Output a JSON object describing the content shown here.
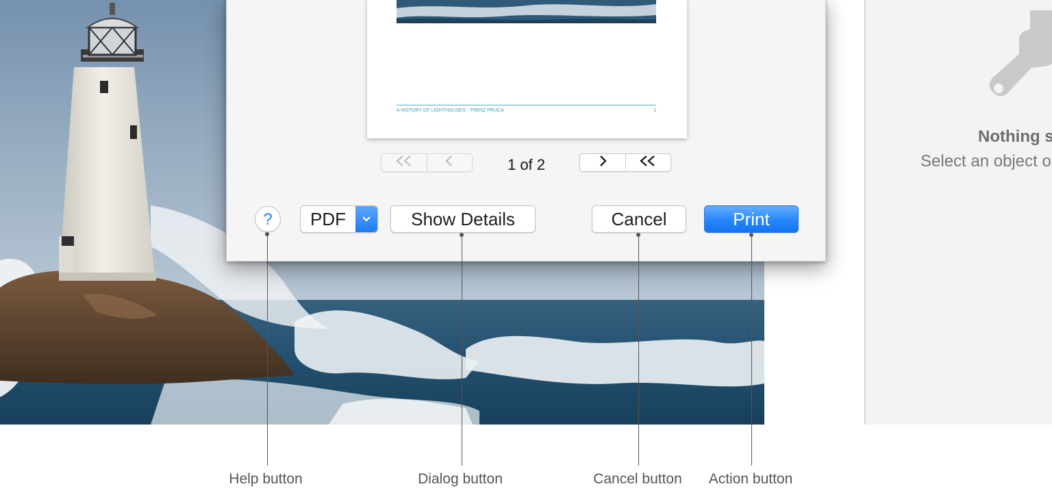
{
  "print_sheet": {
    "preview_page": {
      "footer_text": "A HISTORY OF LIGHTHOUSES - TRENZ PRUCA",
      "page_number": "1"
    },
    "pager": {
      "first_icon": "double-chevron-left-icon",
      "prev_icon": "chevron-left-icon",
      "indicator": "1 of 2",
      "next_icon": "chevron-right-icon",
      "last_icon": "double-chevron-icon"
    },
    "help_button": {
      "label": "?",
      "icon": "question-mark-icon"
    },
    "pdf_menu": {
      "label": "PDF",
      "icon": "chevron-down-icon"
    },
    "show_details_label": "Show Details",
    "cancel_label": "Cancel",
    "print_label": "Print"
  },
  "inspector": {
    "icon": "paintbrush-icon",
    "title": "Nothing s",
    "subtitle": "Select an object o"
  },
  "callouts": [
    {
      "label": "Help button"
    },
    {
      "label": "Dialog button"
    },
    {
      "label": "Cancel button"
    },
    {
      "label": "Action button"
    }
  ],
  "colors": {
    "accent": "#2586fb",
    "sheet_background": "#f5f5f5",
    "footer_text": "#3c98bf",
    "callout_text": "#555555"
  }
}
